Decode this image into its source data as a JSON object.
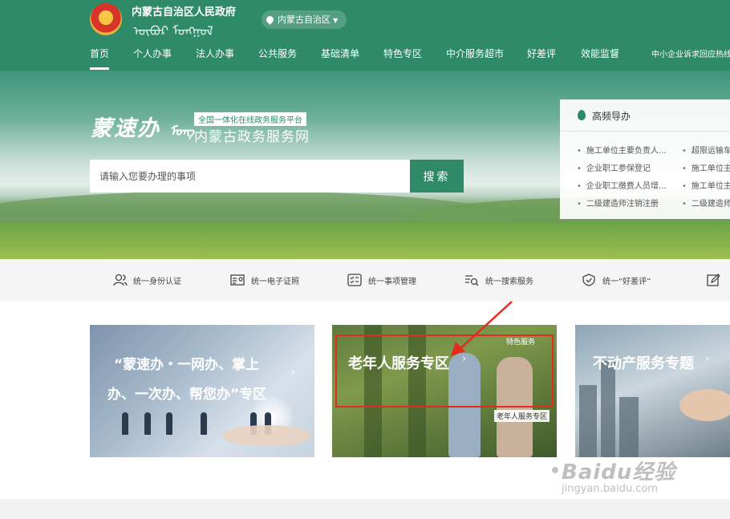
{
  "header": {
    "gov_title": "内蒙古自治区人民政府",
    "mongolian_text": "ᠦᠪᠦᠷ ᠮᠣᠩᠭᠣᠯ",
    "region_selector": "内蒙古自治区"
  },
  "nav": {
    "items": [
      {
        "label": "首页",
        "active": true
      },
      {
        "label": "个人办事"
      },
      {
        "label": "法人办事"
      },
      {
        "label": "公共服务"
      },
      {
        "label": "基础清单"
      },
      {
        "label": "特色专区"
      },
      {
        "label": "中介服务超市"
      },
      {
        "label": "好差评"
      },
      {
        "label": "效能监督"
      },
      {
        "label": "中小企业诉求回应热线"
      }
    ]
  },
  "banner": {
    "calligraphy": "蒙速办",
    "mongolian_text": "ᠮᠣᠩ",
    "tagline": "全国一体化在线政务服务平台",
    "site_name": "内蒙古政务服务网"
  },
  "search": {
    "placeholder": "请输入您要办理的事项",
    "button_label": "搜索"
  },
  "hot_guide": {
    "title": "高频导办",
    "items": [
      "施工单位主要负责人...",
      "超限运输车",
      "企业职工参保登记",
      "施工单位主",
      "企业职工缴费人员增...",
      "施工单位主",
      "二级建造师注销注册",
      "二级建造师"
    ]
  },
  "services": [
    {
      "label": "统一身份认证",
      "icon": "users-icon"
    },
    {
      "label": "统一电子证照",
      "icon": "id-card-icon"
    },
    {
      "label": "统一事项管理",
      "icon": "checklist-icon"
    },
    {
      "label": "统一搜索服务",
      "icon": "search-list-icon"
    },
    {
      "label": "统一“好差评”",
      "icon": "shield-icon"
    }
  ],
  "cards": {
    "card1": {
      "line1": "“蒙速办・一网办、掌上",
      "line2": "办、一次办、帮您办”专区",
      "arrow": "›"
    },
    "card2": {
      "title": "老年人服务专区",
      "tag_special": "特色服务",
      "tag_elder": "老年人服务专区",
      "arrow": "›"
    },
    "card3": {
      "title": "不动产服务专题",
      "arrow": "›"
    }
  },
  "watermark": {
    "main": "Baidu经验",
    "sub": "jingyan.baidu.com"
  },
  "colors": {
    "brand_green": "#2f8a68",
    "highlight_red": "#e52a1e"
  }
}
